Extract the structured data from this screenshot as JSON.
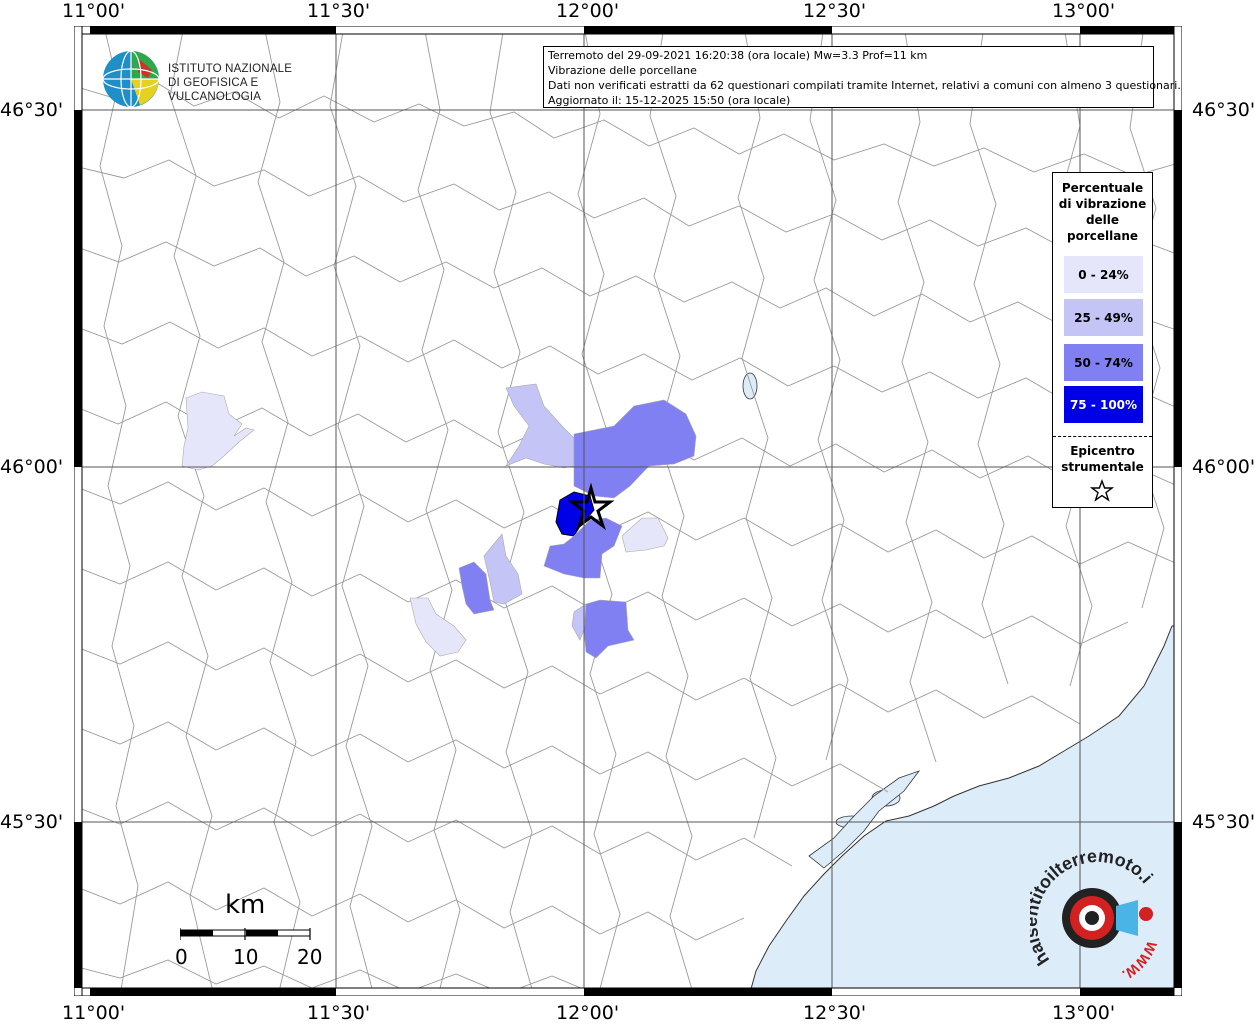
{
  "map": {
    "lon_labels": [
      "11°00'",
      "11°30'",
      "12°00'",
      "12°30'",
      "13°00'"
    ],
    "lat_labels": [
      "46°30'",
      "46°00'",
      "45°30'"
    ],
    "colors": {
      "land": "#ffffff",
      "sea": "#dcecf9",
      "borders": "#9a9a9a",
      "grid": "#555555",
      "class_0_24": "#e6e6fb",
      "class_25_49": "#c4c4f7",
      "class_50_74": "#8080f2",
      "class_75_100": "#0000ff"
    }
  },
  "info": {
    "line1": "Terremoto del 29-09-2021 16:20:38 (ora locale) Mw=3.3 Prof=11 km",
    "line2": "Vibrazione delle porcellane",
    "line3": "Dati non verificati estratti da 62 questionari compilati tramite Internet, relativi a comuni con almeno 3 questionari.",
    "line4": "Aggiornato il: 15-12-2025 15:50 (ora locale)"
  },
  "logo": {
    "line1": "ISTITUTO NAZIONALE",
    "line2": "DI GEOFISICA E VULCANOLOGIA"
  },
  "legend": {
    "title_lines": [
      "Percentuale",
      "di vibrazione",
      "delle",
      "porcellane"
    ],
    "classes": [
      {
        "label": "0 - 24%",
        "color": "#e6e6fb",
        "text_color": "#000000"
      },
      {
        "label": "25 - 49%",
        "color": "#c4c4f7",
        "text_color": "#000000"
      },
      {
        "label": "50 - 74%",
        "color": "#8080f2",
        "text_color": "#000000"
      },
      {
        "label": "75 - 100%",
        "color": "#0000e6",
        "text_color": "#ffffff"
      }
    ],
    "epicenter_lines": [
      "Epicentro",
      "strumentale"
    ],
    "epicenter_icon": "star-outline-icon"
  },
  "scale": {
    "title": "km",
    "labels": [
      "0",
      "10",
      "20"
    ]
  },
  "watermark": {
    "text": "haisentitoilterremoto.it",
    "url_text": "WWW.",
    "icon": "earthquake-target-icon"
  }
}
